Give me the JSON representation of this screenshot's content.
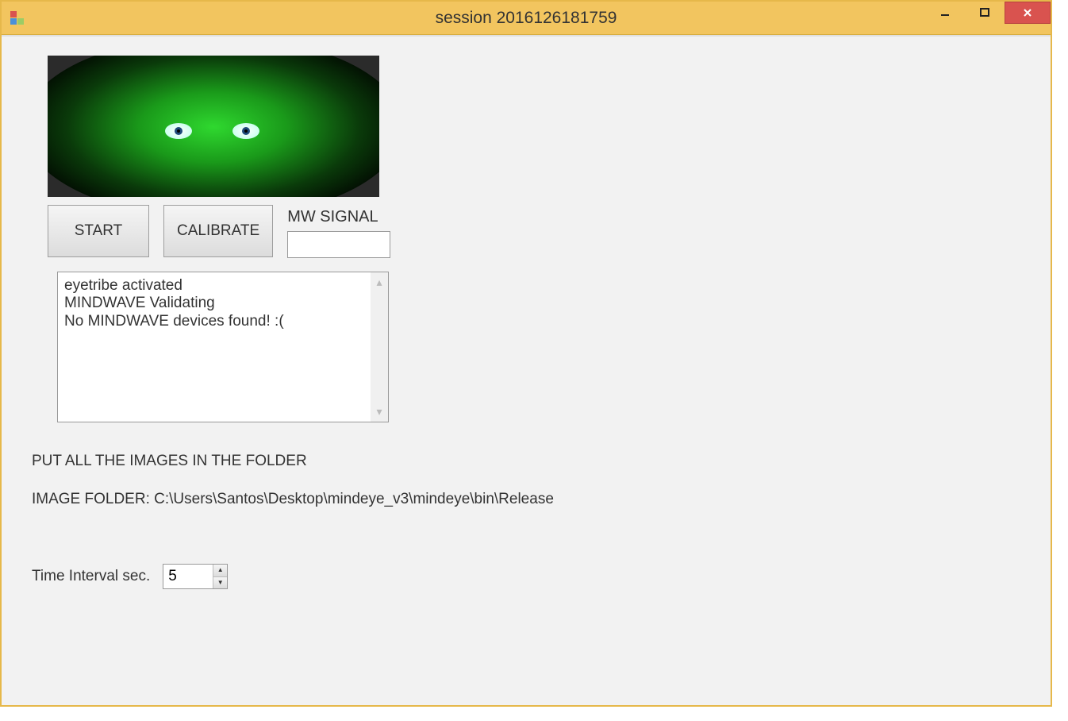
{
  "window": {
    "title": "session 2016126181759"
  },
  "buttons": {
    "start": "START",
    "calibrate": "CALIBRATE"
  },
  "mw": {
    "label": "MW SIGNAL",
    "value": ""
  },
  "log": {
    "text": "eyetribe activated\nMINDWAVE Validating\nNo MINDWAVE devices found! :("
  },
  "instructions": {
    "put_images": "PUT ALL THE IMAGES IN THE FOLDER",
    "folder_label": "IMAGE FOLDER: C:\\Users\\Santos\\Desktop\\mindeye_v3\\mindeye\\bin\\Release"
  },
  "interval": {
    "label": "Time Interval sec.",
    "value": "5"
  }
}
